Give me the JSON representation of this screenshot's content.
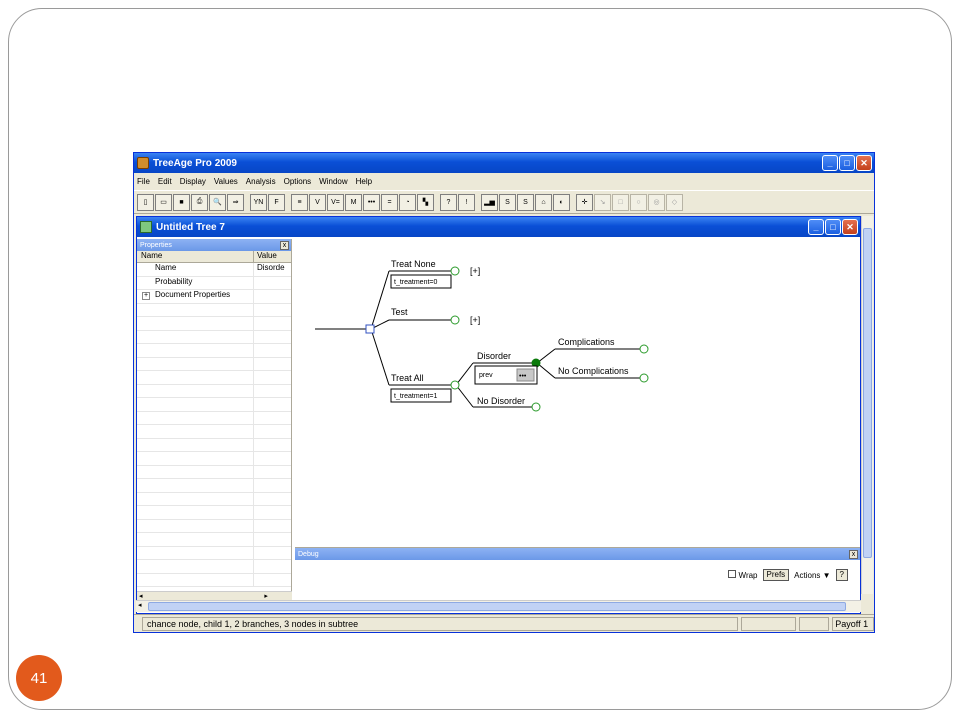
{
  "slide": {
    "page_number": "41"
  },
  "app": {
    "title": "TreeAge Pro 2009"
  },
  "menu": [
    "File",
    "Edit",
    "Display",
    "Values",
    "Analysis",
    "Options",
    "Window",
    "Help"
  ],
  "window_buttons": {
    "minimize": "_",
    "maximize": "□",
    "close": "✕"
  },
  "toolbar": [
    {
      "glyph": "▯",
      "name": "new-icon"
    },
    {
      "glyph": "▭",
      "name": "open-icon"
    },
    {
      "glyph": "■",
      "name": "save-icon"
    },
    {
      "glyph": "⎙",
      "name": "print-icon"
    },
    {
      "glyph": "🔍",
      "name": "preview-icon"
    },
    {
      "glyph": "⇒",
      "name": "export-icon"
    },
    {
      "glyph": "YN",
      "name": "yes-no-icon"
    },
    {
      "glyph": "F",
      "name": "function-icon"
    },
    {
      "glyph": "≡",
      "name": "list-icon"
    },
    {
      "glyph": "V",
      "name": "variables-icon"
    },
    {
      "glyph": "V=",
      "name": "define-variable-icon"
    },
    {
      "glyph": "M",
      "name": "markov-icon"
    },
    {
      "glyph": "•••",
      "name": "dots-icon"
    },
    {
      "glyph": "=",
      "name": "equals-icon"
    },
    {
      "glyph": "◔",
      "name": "clock-icon"
    },
    {
      "glyph": "▚",
      "name": "node-icon"
    },
    {
      "glyph": "?",
      "name": "help-icon"
    },
    {
      "glyph": "!",
      "name": "alert-icon"
    },
    {
      "glyph": "▂▅",
      "name": "chart-icon"
    },
    {
      "glyph": "S",
      "name": "sens-icon"
    },
    {
      "glyph": "S",
      "name": "sens2-icon"
    },
    {
      "glyph": "⌂",
      "name": "tree-icon"
    },
    {
      "glyph": "◐",
      "name": "color-icon"
    },
    {
      "glyph": "✛",
      "name": "move-icon"
    },
    {
      "glyph": "↘",
      "name": "arrow-icon"
    },
    {
      "glyph": "□",
      "name": "square-node-icon"
    },
    {
      "glyph": "○",
      "name": "circle-node-icon"
    },
    {
      "glyph": "◎",
      "name": "double-circle-icon"
    },
    {
      "glyph": "◇",
      "name": "diamond-icon"
    }
  ],
  "document": {
    "title": "Untitled Tree 7"
  },
  "properties": {
    "title": "Properties",
    "close": "x",
    "col_name": "Name",
    "col_value": "Value",
    "rows": [
      {
        "name": "Name",
        "value": "Disorde"
      },
      {
        "name": "Probability",
        "value": ""
      },
      {
        "name": "Document Properties",
        "value": "",
        "expander": "+"
      }
    ]
  },
  "tree": {
    "branches": [
      {
        "label": "Treat None",
        "value": "t_treatment=0",
        "collapsed": "[+]"
      },
      {
        "label": "Test",
        "collapsed": "[+]"
      },
      {
        "label": "Treat All",
        "value": "t_treatment=1"
      },
      {
        "label": "Disorder",
        "value": "prev",
        "ellipsis": "•••"
      },
      {
        "label": "No Disorder"
      },
      {
        "label": "Complications"
      },
      {
        "label": "No Complications"
      }
    ],
    "colors": {
      "line": "#000000",
      "node": "#2a9a2a",
      "selected_node": "#0a7a0a",
      "decision": "#3050c0"
    }
  },
  "debug": {
    "title": "Debug",
    "close": "x",
    "wrap_label": "Wrap",
    "prefs_label": "Prefs",
    "actions_label": "Actions ▼",
    "help_label": "?"
  },
  "status": {
    "text": "chance node, child 1, 2 branches, 3 nodes in subtree",
    "payoff": "Payoff 1"
  }
}
